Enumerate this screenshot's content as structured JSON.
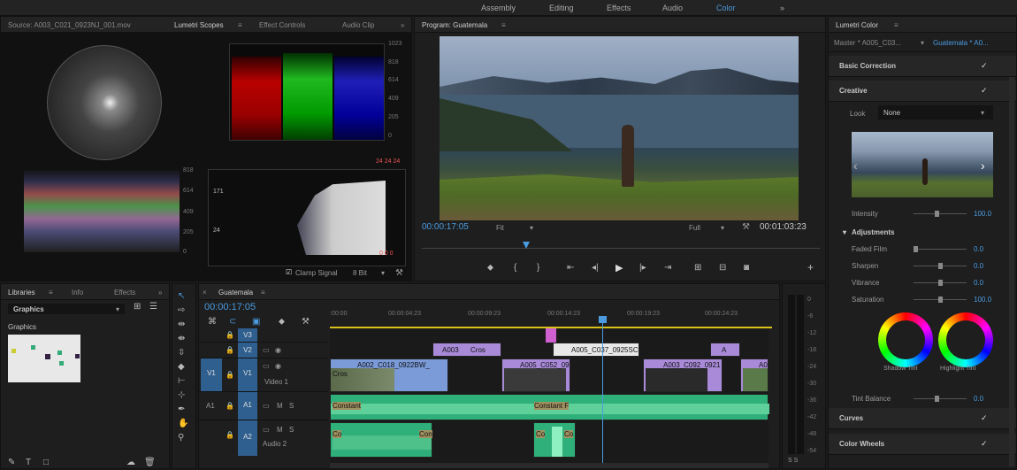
{
  "workspaces": [
    "Assembly",
    "Editing",
    "Effects",
    "Audio",
    "Color"
  ],
  "active_workspace": "Color",
  "source_panel": {
    "tabs": [
      "Source: A003_C021_0923NJ_001.mov",
      "Lumetri Scopes",
      "Effect Controls",
      "Audio Clip"
    ],
    "parade_scale": [
      "1023",
      "818",
      "614",
      "409",
      "205",
      "0"
    ],
    "waveform_scale": [
      "1023",
      "818",
      "614",
      "409",
      "205",
      "0"
    ],
    "histogram_values": [
      "171",
      "24"
    ],
    "corner_rgb": "24 24 24",
    "rgb_bottom": "0 0 0",
    "clamp_label": "Clamp Signal",
    "bit_depth": "8 Bit"
  },
  "program": {
    "title": "Program: Guatemala",
    "timecode": "00:00:17:05",
    "duration": "00:01:03:23",
    "fit": "Fit",
    "quality": "Full"
  },
  "lumetri": {
    "title": "Lumetri Color",
    "tabs": [
      "Master * A005_C03...",
      "Guatemala * A0..."
    ],
    "basic_correction": "Basic Correction",
    "creative": "Creative",
    "look_label": "Look",
    "look_value": "None",
    "intensity_label": "Intensity",
    "intensity_value": "100.0",
    "adjustments": "Adjustments",
    "sliders": [
      {
        "label": "Faded Film",
        "value": "0.0",
        "level": 0.0
      },
      {
        "label": "Sharpen",
        "value": "0.0",
        "level": 0.5
      },
      {
        "label": "Vibrance",
        "value": "0.0",
        "level": 0.5
      },
      {
        "label": "Saturation",
        "value": "100.0",
        "level": 0.5
      }
    ],
    "shadow_tint": "Shadow Tint",
    "highlight_tint": "Highlight Tint",
    "tint_balance_label": "Tint Balance",
    "tint_balance_value": "0.0",
    "curves": "Curves",
    "color_wheels": "Color Wheels"
  },
  "libraries": {
    "tabs": [
      "Libraries",
      "Info",
      "Effects"
    ],
    "dropdown": "Graphics",
    "section": "Graphics"
  },
  "timeline": {
    "tab": "Guatemala",
    "timecode": "00:00:17:05",
    "ruler": [
      ":00:00",
      "00:00:04:23",
      "00:00:09:23",
      "00:00:14:23",
      "00:00:19:23",
      "00:00:24:23"
    ],
    "tracks": [
      {
        "id": "V3",
        "name": ""
      },
      {
        "id": "V2",
        "name": ""
      },
      {
        "id": "V1",
        "name": "Video 1",
        "src": "V1"
      },
      {
        "id": "A1",
        "name": "",
        "src": "A1"
      },
      {
        "id": "A2",
        "name": "Audio 2"
      }
    ],
    "clips": {
      "v2a": "A003",
      "v2b": "Cros",
      "v2c": "A005_C037_0925SC",
      "v2d": "A",
      "v1a": "A002_C018_0922BW_",
      "v1b": "A005_C052_09",
      "v1c": "A003_C092_0921",
      "v1d": "A0",
      "cross": "Cros",
      "a1a": "Constant",
      "a1b": "Constant F",
      "a2a": "Co",
      "a2b": "Con",
      "a2c": "Co",
      "a2d": "Co"
    }
  },
  "meter_scale": [
    "0",
    "-6",
    "-12",
    "-18",
    "-24",
    "-30",
    "-36",
    "-42",
    "-48",
    "-54"
  ],
  "meter_solo": "S S"
}
